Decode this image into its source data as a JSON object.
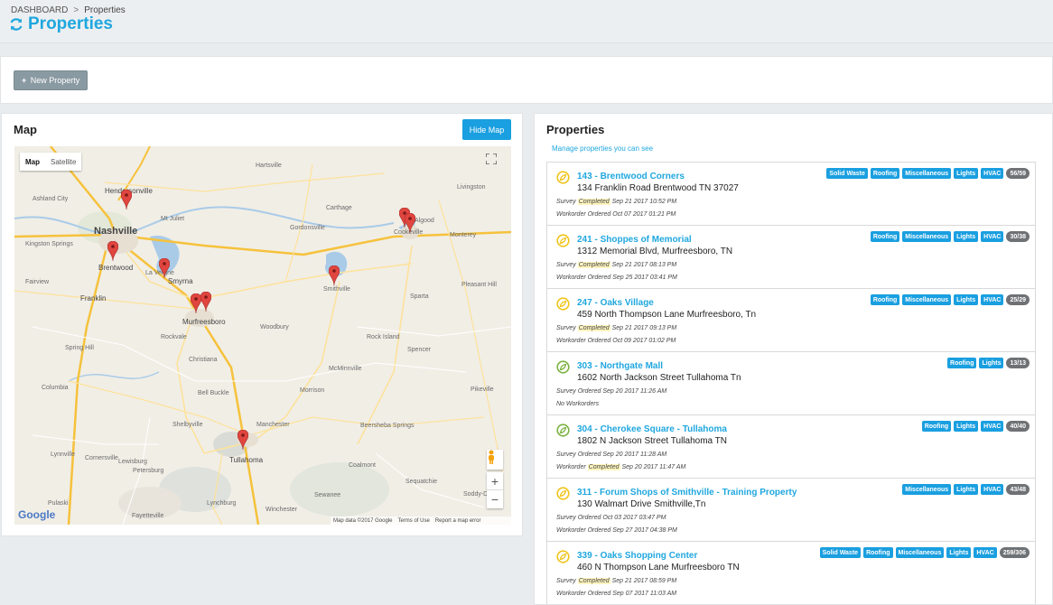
{
  "breadcrumb": {
    "root": "DASHBOARD",
    "separator": ">",
    "current": "Properties"
  },
  "page_title": "Properties",
  "toolbar": {
    "new_property_label": "New Property"
  },
  "map_panel": {
    "title": "Map",
    "hide_map_label": "Hide Map",
    "map_type": {
      "map": "Map",
      "satellite": "Satellite"
    },
    "footer": {
      "data": "Map data ©2017 Google",
      "terms": "Terms of Use",
      "report": "Report a map error"
    },
    "google_logo": "Google",
    "labels": [
      "Nashville",
      "Hendersonville",
      "Franklin",
      "Brentwood",
      "Smyrna",
      "La Vergne",
      "Murfreesboro",
      "Smithville",
      "Cookeville",
      "Tullahoma",
      "Manchester",
      "Shelbyville",
      "McMinnville",
      "Woodbury",
      "Columbia",
      "Spring Hill",
      "Lynchburg",
      "Winchester",
      "Pulaski",
      "Fayetteville",
      "Sparta",
      "Gordonsville",
      "Carthage",
      "Mt Juliet",
      "Hartsville",
      "Livingston",
      "Monterey",
      "Ashland City",
      "Kingston Springs",
      "Fairview",
      "Lewisburg",
      "Bell Buckle",
      "Christiana",
      "Morrison",
      "Spencer",
      "Rock Island",
      "Pikeville",
      "Beersheba Springs",
      "Coalmont",
      "Sewanee",
      "Sequatchie",
      "Soddy-Daisy",
      "Cornersville",
      "Petersburg",
      "Lynnville",
      "Pleasant Hill",
      "Rockvale",
      "Algood"
    ]
  },
  "props_panel": {
    "title": "Properties",
    "subtitle": "Manage properties you can see",
    "items": [
      {
        "name": "143 - Brentwood Corners",
        "address": "134 Franklin Road Brentwood TN 37027",
        "status_color": "#f0c419",
        "survey_pre": "Survey",
        "survey_status": "Completed",
        "survey_highlight": true,
        "survey_date": "Sep 21 2017 10:52 PM",
        "work_pre": "Workorder Ordered",
        "work_status": "",
        "work_highlight": false,
        "work_date": "Oct 07 2017 01:21 PM",
        "tags": [
          "Solid Waste",
          "Roofing",
          "Miscellaneous",
          "Lights",
          "HVAC"
        ],
        "count": "56/59"
      },
      {
        "name": "241 - Shoppes of Memorial",
        "address": "1312 Memorial Blvd, Murfreesboro, TN",
        "status_color": "#f0c419",
        "survey_pre": "Survey",
        "survey_status": "Completed",
        "survey_highlight": true,
        "survey_date": "Sep 21 2017 08:13 PM",
        "work_pre": "Workorder Ordered",
        "work_status": "",
        "work_highlight": false,
        "work_date": "Sep 25 2017 03:41 PM",
        "tags": [
          "Roofing",
          "Miscellaneous",
          "Lights",
          "HVAC"
        ],
        "count": "30/38"
      },
      {
        "name": "247 - Oaks Village",
        "address": "459 North Thompson Lane Murfreesboro, Tn",
        "status_color": "#f0c419",
        "survey_pre": "Survey",
        "survey_status": "Completed",
        "survey_highlight": true,
        "survey_date": "Sep 21 2017 09:13 PM",
        "work_pre": "Workorder Ordered",
        "work_status": "",
        "work_highlight": false,
        "work_date": "Oct 09 2017 01:02 PM",
        "tags": [
          "Roofing",
          "Miscellaneous",
          "Lights",
          "HVAC"
        ],
        "count": "25/29"
      },
      {
        "name": "303 - Northgate Mall",
        "address": "1602 North Jackson Street Tullahoma Tn",
        "status_color": "#7cb342",
        "survey_pre": "Survey Ordered",
        "survey_status": "",
        "survey_highlight": false,
        "survey_date": "Sep 20 2017 11:26 AM",
        "work_pre": "No Workorders",
        "work_status": "",
        "work_highlight": false,
        "work_date": "",
        "tags": [
          "Roofing",
          "Lights"
        ],
        "count": "13/13"
      },
      {
        "name": "304 - Cherokee Square - Tullahoma",
        "address": "1802 N Jackson Street Tullahoma TN",
        "status_color": "#7cb342",
        "survey_pre": "Survey Ordered",
        "survey_status": "",
        "survey_highlight": false,
        "survey_date": "Sep 20 2017 11:28 AM",
        "work_pre": "Workorder",
        "work_status": "Completed",
        "work_highlight": true,
        "work_date": "Sep 20 2017 11:47 AM",
        "tags": [
          "Roofing",
          "Lights",
          "HVAC"
        ],
        "count": "40/40"
      },
      {
        "name": "311 - Forum Shops of Smithville - Training Property",
        "address": "130 Walmart Drive Smithville,Tn",
        "status_color": "#f0c419",
        "survey_pre": "Survey Ordered",
        "survey_status": "",
        "survey_highlight": false,
        "survey_date": "Oct 03 2017 03:47 PM",
        "work_pre": "Workorder Ordered",
        "work_status": "",
        "work_highlight": false,
        "work_date": "Sep 27 2017 04:38 PM",
        "tags": [
          "Miscellaneous",
          "Lights",
          "HVAC"
        ],
        "count": "43/48"
      },
      {
        "name": "339 - Oaks Shopping Center",
        "address": "460 N Thompson Lane Murfreesboro TN",
        "status_color": "#f0c419",
        "survey_pre": "Survey",
        "survey_status": "Completed",
        "survey_highlight": true,
        "survey_date": "Sep 21 2017 08:59 PM",
        "work_pre": "Workorder Ordered",
        "work_status": "",
        "work_highlight": false,
        "work_date": "Sep 07 2017 11:03 AM",
        "tags": [
          "Solid Waste",
          "Roofing",
          "Miscellaneous",
          "Lights",
          "HVAC"
        ],
        "count": "259/306"
      }
    ]
  },
  "colors": {
    "accent": "#1fa7df",
    "button_blue": "#1a9fe0",
    "pin_red": "#e0453f",
    "count_gray": "#6f7275"
  }
}
